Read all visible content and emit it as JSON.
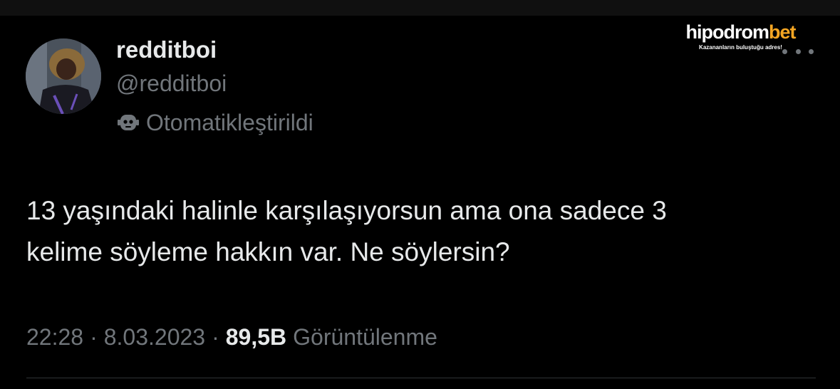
{
  "author": {
    "display_name": "redditboi",
    "handle": "@redditboi",
    "automated_label": "Otomatikleştirildi",
    "avatar_icon": "profile-photo"
  },
  "brand": {
    "name_part1": "hipodrom",
    "name_part2": "bet",
    "tagline": "Kazananların buluştuğu adres!",
    "accent_color": "#f5a623"
  },
  "tweet": {
    "text_line1": "13 yaşındaki halinle karşılaşıyorsun ama ona sadece 3",
    "text_line2": "kelime söyleme hakkın var. Ne söylersin?"
  },
  "meta": {
    "time": "22:28",
    "separator": "·",
    "date": "8.03.2023",
    "views_count": "89,5B",
    "views_label": "Görüntülenme"
  },
  "colors": {
    "background": "#000000",
    "primary_text": "#e7e9ea",
    "secondary_text": "#71767b",
    "divider": "#2f3336"
  }
}
